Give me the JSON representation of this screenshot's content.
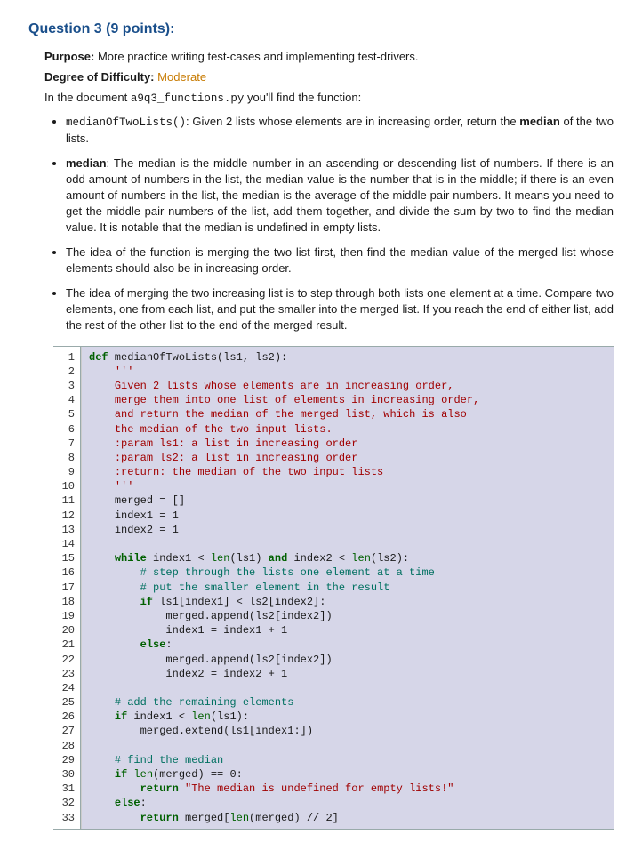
{
  "title": "Question 3 (9 points):",
  "purpose_label": "Purpose:",
  "purpose_text": "More practice writing test-cases and implementing test-drivers.",
  "difficulty_label": "Degree of Difficulty:",
  "difficulty_value": "Moderate",
  "intro_pre": "In the document ",
  "intro_file": "a9q3_functions.py",
  "intro_post": " you'll find the function:",
  "bullets": {
    "b1_fn": "medianOfTwoLists()",
    "b1_text": ": Given 2 lists whose elements are in increasing order, return the ",
    "b1_bold": "median",
    "b1_tail": " of the two lists.",
    "b2_bold": "median",
    "b2_text": ": The median is the middle number in an ascending or descending list of numbers. If there is an odd amount of numbers in the list, the median value is the number that is in the middle; if there is an even amount of numbers in the list, the median is the average of the middle pair numbers. It means you need to get the middle pair numbers of the list, add them together, and divide the sum by two to find the median value. It is notable that the median is undefined in empty lists.",
    "b3_text": "The idea of the function is merging the two list first, then find the median value of the merged list whose elements should also be in increasing order.",
    "b4_text": "The idea of merging the two increasing list is to step through both lists one element at a time. Compare two elements, one from each list, and put the smaller into the merged list. If you reach the end of either list, add the rest of the other list to the end of the merged result."
  },
  "code_lines": 33,
  "chart_data": null,
  "code": {
    "l1": {
      "pre": "",
      "kw": "def",
      "rest": " medianOfTwoLists(ls1, ls2):"
    },
    "l2": {
      "pre": "    ",
      "str": "'''"
    },
    "l3": {
      "pre": "    ",
      "str": "Given 2 lists whose elements are in increasing order,"
    },
    "l4": {
      "pre": "    ",
      "str": "merge them into one list of elements in increasing order,"
    },
    "l5": {
      "pre": "    ",
      "str": "and return the median of the merged list, which is also"
    },
    "l6": {
      "pre": "    ",
      "str": "the median of the two input lists."
    },
    "l7": {
      "pre": "    ",
      "str": ":param ls1: a list in increasing order"
    },
    "l8": {
      "pre": "    ",
      "str": ":param ls2: a list in increasing order"
    },
    "l9": {
      "pre": "    ",
      "str": ":return: the median of the two input lists"
    },
    "l10": {
      "pre": "    ",
      "str": "'''"
    },
    "l11": {
      "pre": "    ",
      "txt": "merged = []"
    },
    "l12": {
      "pre": "    ",
      "txt": "index1 = 1"
    },
    "l13": {
      "pre": "    ",
      "txt": "index2 = 1"
    },
    "l14": {
      "pre": "",
      "txt": ""
    },
    "l15": {
      "pre": "    ",
      "kw": "while",
      "mid": " index1 < ",
      "bi": "len",
      "mid2": "(ls1) ",
      "kw2": "and",
      "mid3": " index2 < ",
      "bi2": "len",
      "tail": "(ls2):"
    },
    "l16": {
      "pre": "        ",
      "cmt": "# step through the lists one element at a time"
    },
    "l17": {
      "pre": "        ",
      "cmt": "# put the smaller element in the result"
    },
    "l18": {
      "pre": "        ",
      "kw": "if",
      "rest": " ls1[index1] < ls2[index2]:"
    },
    "l19": {
      "pre": "            ",
      "txt": "merged.append(ls2[index2])"
    },
    "l20": {
      "pre": "            ",
      "txt": "index1 = index1 + 1"
    },
    "l21": {
      "pre": "        ",
      "kw": "else",
      "rest": ":"
    },
    "l22": {
      "pre": "            ",
      "txt": "merged.append(ls2[index2])"
    },
    "l23": {
      "pre": "            ",
      "txt": "index2 = index2 + 1"
    },
    "l24": {
      "pre": "",
      "txt": ""
    },
    "l25": {
      "pre": "    ",
      "cmt": "# add the remaining elements"
    },
    "l26": {
      "pre": "    ",
      "kw": "if",
      "mid": " index1 < ",
      "bi": "len",
      "tail": "(ls1):"
    },
    "l27": {
      "pre": "        ",
      "txt": "merged.extend(ls1[index1:])"
    },
    "l28": {
      "pre": "",
      "txt": ""
    },
    "l29": {
      "pre": "    ",
      "cmt": "# find the median"
    },
    "l30": {
      "pre": "    ",
      "kw": "if",
      "mid": " ",
      "bi": "len",
      "mid2": "(merged) == 0:"
    },
    "l31": {
      "pre": "        ",
      "kw": "return",
      "mid": " ",
      "str": "\"The median is undefined for empty lists!\""
    },
    "l32": {
      "pre": "    ",
      "kw": "else",
      "rest": ":"
    },
    "l33": {
      "pre": "        ",
      "kw": "return",
      "mid": " merged[",
      "bi": "len",
      "tail": "(merged) // 2]"
    }
  }
}
